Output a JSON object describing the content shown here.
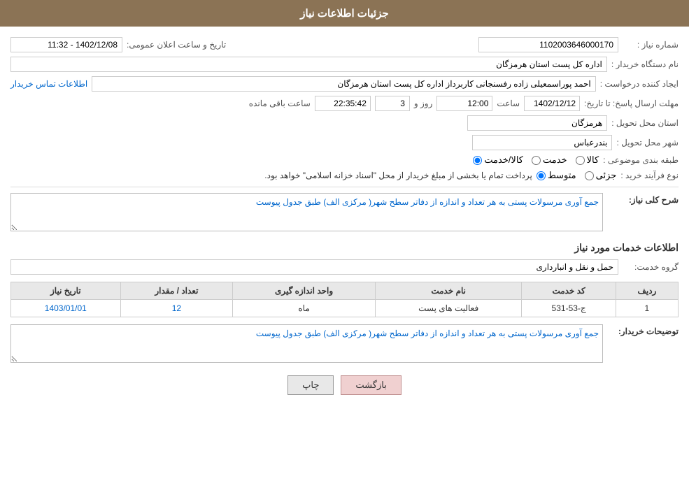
{
  "header": {
    "title": "جزئیات اطلاعات نیاز"
  },
  "fields": {
    "need_number_label": "شماره نیاز :",
    "need_number_value": "1102003646000170",
    "org_name_label": "نام دستگاه خریدار :",
    "org_name_value": "اداره کل پست استان هرمزگان",
    "creator_label": "ایجاد کننده درخواست :",
    "creator_value": "احمد پوراسمعیلی زاده رفسنجانی کاربرداز اداره کل پست استان هرمزگان",
    "creator_link": "اطلاعات تماس خریدار",
    "deadline_label": "مهلت ارسال پاسخ: تا تاریخ:",
    "deadline_date": "1402/12/12",
    "deadline_time_label": "ساعت",
    "deadline_time": "12:00",
    "deadline_days_label": "روز و",
    "deadline_days": "3",
    "deadline_remaining_label": "ساعت باقی مانده",
    "deadline_remaining": "22:35:42",
    "province_label": "استان محل تحویل :",
    "province_value": "هرمزگان",
    "city_label": "شهر محل تحویل :",
    "city_value": "بندرعباس",
    "category_label": "طبقه بندی موضوعی :",
    "category_options": [
      "کالا",
      "خدمت",
      "کالا/خدمت"
    ],
    "category_selected": "کالا",
    "purchase_type_label": "نوع فرآیند خرید :",
    "purchase_type_options": [
      "جزئی",
      "متوسط"
    ],
    "purchase_type_selected": "متوسط",
    "purchase_note": "پرداخت تمام یا بخشی از مبلغ خریدار از محل \"اسناد خزانه اسلامی\" خواهد بود.",
    "public_announcement_label": "تاریخ و ساعت اعلان عمومی:",
    "public_announcement_value": "1402/12/08 - 11:32",
    "need_description_label": "شرح کلی نیاز:",
    "need_description_value": "جمع آوری مرسولات پستی به هر تعداد و اندازه از دفاتر سطح شهر( مرکزی الف) طبق جدول پیوست",
    "services_label": "اطلاعات خدمات مورد نیاز",
    "service_group_label": "گروه خدمت:",
    "service_group_value": "حمل و نقل و انبارداری",
    "table": {
      "columns": [
        "ردیف",
        "کد خدمت",
        "نام خدمت",
        "واحد اندازه گیری",
        "تعداد / مقدار",
        "تاریخ نیاز"
      ],
      "rows": [
        {
          "row_num": "1",
          "service_code": "ج-53-531",
          "service_name": "فعالیت های پست",
          "unit": "ماه",
          "quantity": "12",
          "date": "1403/01/01"
        }
      ]
    },
    "buyer_desc_label": "توضیحات خریدار:",
    "buyer_desc_value": "جمع آوری مرسولات پستی به هر تعداد و اندازه از دفاتر سطح شهر( مرکزی الف) طبق جدول پیوست"
  },
  "buttons": {
    "print_label": "چاپ",
    "back_label": "بازگشت"
  }
}
